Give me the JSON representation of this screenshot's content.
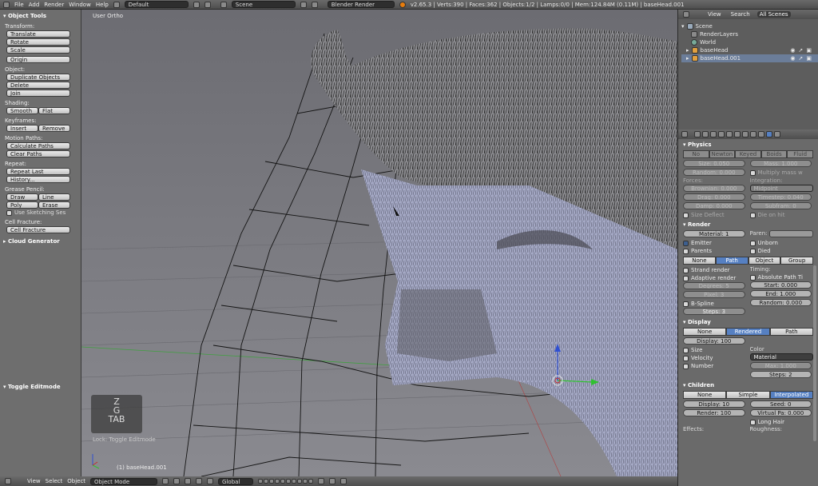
{
  "topbar": {
    "menus": [
      "File",
      "Add",
      "Render",
      "Window",
      "Help"
    ],
    "layout": "Default",
    "scene": "Scene",
    "engine": "Blender Render",
    "stats": "v2.65.3 | Verts:390 | Faces:362 | Objects:1/2 | Lamps:0/0 | Mem:124.84M (0.11M) | baseHead.001"
  },
  "toolshelf": {
    "title": "Object Tools",
    "transform_label": "Transform:",
    "translate": "Translate",
    "rotate": "Rotate",
    "scale": "Scale",
    "origin": "Origin",
    "object_label": "Object:",
    "duplicate": "Duplicate Objects",
    "delete": "Delete",
    "join": "Join",
    "shading_label": "Shading:",
    "smooth": "Smooth",
    "flat": "Flat",
    "keyframes_label": "Keyframes:",
    "insert": "Insert",
    "remove": "Remove",
    "motion_label": "Motion Paths:",
    "calc_paths": "Calculate Paths",
    "clear_paths": "Clear Paths",
    "repeat_label": "Repeat:",
    "repeat_last": "Repeat Last",
    "history": "History...",
    "grease_label": "Grease Pencil:",
    "draw": "Draw",
    "line": "Line",
    "poly": "Poly",
    "erase": "Erase",
    "sketching": "Use Sketching Ses",
    "cell_label": "Cell Fracture:",
    "cell_fracture": "Cell Fracture",
    "cloud": "Cloud Generator",
    "toggle_edit": "Toggle Editmode"
  },
  "viewport": {
    "view_label": "User Ortho",
    "object_label": "(1) baseHead.001",
    "zgtab": [
      "Z",
      "G",
      "TAB"
    ],
    "lock_label": "Lock: Toggle Editmode"
  },
  "bottombar": {
    "items": [
      "View",
      "Select",
      "Object"
    ],
    "mode": "Object Mode",
    "orientation": "Global"
  },
  "outliner": {
    "tabs": [
      "View",
      "Search",
      "All Scenes"
    ],
    "items": [
      {
        "label": "Scene",
        "indent": 0
      },
      {
        "label": "RenderLayers",
        "indent": 1
      },
      {
        "label": "World",
        "indent": 1
      },
      {
        "label": "baseHead",
        "indent": 1
      },
      {
        "label": "baseHead.001",
        "indent": 1
      }
    ]
  },
  "physics": {
    "title": "Physics",
    "modes": [
      "No",
      "Newton",
      "Keyed",
      "Boids",
      "Fluid"
    ],
    "size": "Size: 0.050",
    "mass": "Mass: 1.000",
    "random": "Random: 0.000",
    "multiply": "Multiply mass w",
    "forces_label": "Forces:",
    "integration_label": "Integration:",
    "brownian": "Brownian: 0.000",
    "midpoint": "Midpoint",
    "drag": "Drag: 0.000",
    "timestep": "Timestep: 0.040",
    "damp": "Damp: 0.000",
    "subframes": "Subfram: 0",
    "size_deflect": "Size Deflect",
    "die_on_hit": "Die on hit"
  },
  "render": {
    "title": "Render",
    "material": "Material: 1",
    "parent": "Paren:",
    "emitter": "Emitter",
    "unborn": "Unborn",
    "parents": "Parents",
    "died": "Died",
    "modes": [
      "None",
      "Path",
      "Object",
      "Group"
    ],
    "strand": "Strand render",
    "timing": "Timing:",
    "adaptive": "Adaptive render",
    "absolute": "Absolute Path Ti",
    "degrees": "Degrees: 5",
    "start": "Start: 0.000",
    "pixel": "Pixel: 3",
    "end": "End: 1.000",
    "bspline": "B-Spline",
    "random": "Random: 0.000",
    "steps": "Steps: 3"
  },
  "display": {
    "title": "Display",
    "modes": [
      "None",
      "Rendered",
      "Path"
    ],
    "display_val": "Display: 100",
    "size": "Size",
    "color": "Color",
    "velocity": "Velocity",
    "material": "Material",
    "number": "Number",
    "max": "Max: 1.000",
    "steps": "Steps: 2"
  },
  "children": {
    "title": "Children",
    "modes": [
      "None",
      "Simple",
      "Interpolated"
    ],
    "display": "Display: 10",
    "seed": "Seed: 0",
    "render": "Render: 100",
    "virtual": "Virtual Pa: 0.000",
    "long_hair": "Long Hair",
    "effects": "Effects:",
    "roughness": "Roughness:"
  }
}
